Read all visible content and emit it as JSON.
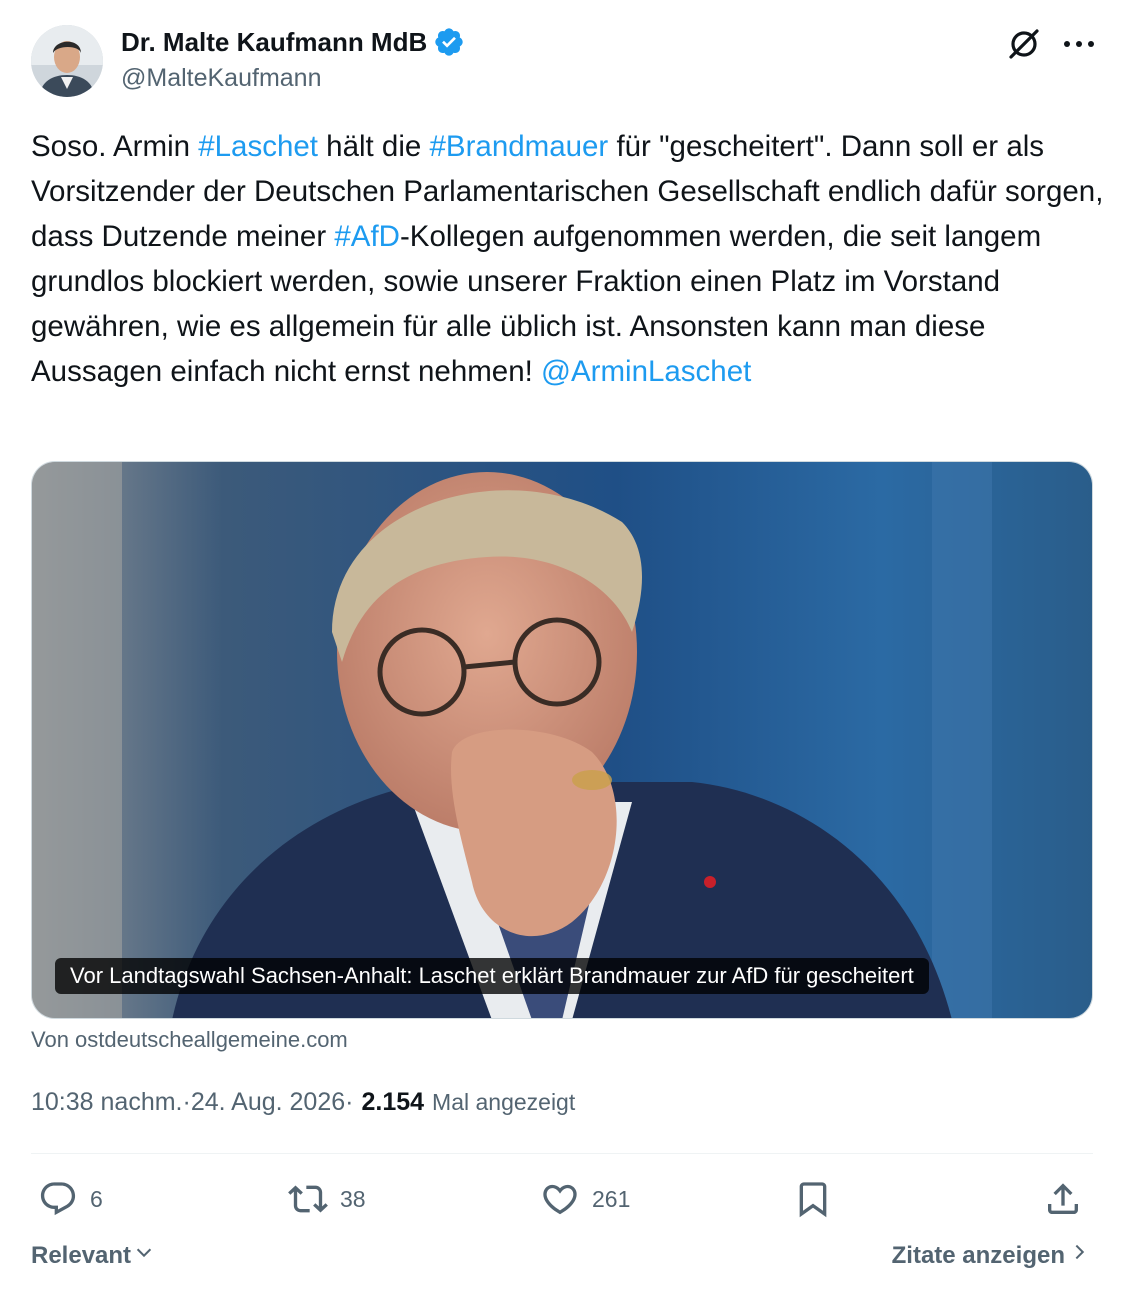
{
  "author": {
    "display_name": "Dr. Malte Kaufmann MdB",
    "handle": "@MalteKaufmann",
    "verified_icon": "verified-badge-icon"
  },
  "header_actions": {
    "grok_icon": "grok-icon",
    "more_icon": "more-options-icon"
  },
  "tweet": {
    "segments": [
      {
        "text": "Soso. Armin ",
        "type": "text"
      },
      {
        "text": "#Laschet",
        "type": "hashtag"
      },
      {
        "text": " hält die ",
        "type": "text"
      },
      {
        "text": "#Brandmauer",
        "type": "hashtag"
      },
      {
        "text": " für \"gescheitert\". Dann soll er als Vorsitzender der Deutschen Parlamentarischen Gesellschaft endlich dafür sorgen, dass Dutzende meiner ",
        "type": "text"
      },
      {
        "text": "#AfD",
        "type": "hashtag"
      },
      {
        "text": "-Kollegen aufgenommen werden, die seit langem  grundlos blockiert werden, sowie unserer Fraktion einen Platz im Vorstand gewähren, wie es allgemein für alle üblich ist. Ansonsten kann man diese Aussagen einfach nicht ernst nehmen! ",
        "type": "text"
      },
      {
        "text": "@ArminLaschet",
        "type": "mention"
      }
    ]
  },
  "card": {
    "caption": "Vor Landtagswahl Sachsen-Anhalt: Laschet erklärt Brandmauer zur AfD für gescheitert",
    "source": "Von ostdeutscheallgemeine.com"
  },
  "meta": {
    "time": "10:38 nachm.",
    "separator": " · ",
    "date": "24. Aug. 2026",
    "separator2": " · ",
    "views_count": "2.154",
    "views_label": "Mal angezeigt"
  },
  "actions": {
    "replies": "6",
    "reposts": "38",
    "likes": "261"
  },
  "footer": {
    "relevant_label": "Relevant",
    "quotes_label": "Zitate anzeigen"
  },
  "colors": {
    "link": "#1d9bf0",
    "secondary_text": "#536471",
    "primary_text": "#0f1419"
  }
}
